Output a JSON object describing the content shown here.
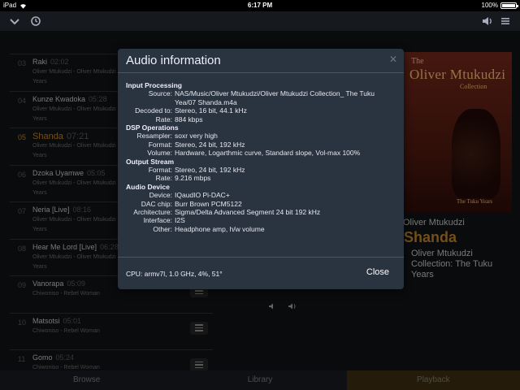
{
  "status_bar": {
    "device": "iPad",
    "time": "6:17 PM",
    "battery": "100%",
    "battery_level": 1.0
  },
  "queue": [
    {
      "num": "03",
      "title": "Raki",
      "duration": "02:02",
      "artist": "Oliver Mtukudzi - Oliver Mtukudzi Collection",
      "years": "Years",
      "current": false,
      "menu": false
    },
    {
      "num": "04",
      "title": "Kunze Kwadoka",
      "duration": "05:28",
      "artist": "Oliver Mtukudzi - Oliver Mtukudzi Collection",
      "years": "Years",
      "current": false,
      "menu": false
    },
    {
      "num": "05",
      "title": "Shanda",
      "duration": "07:21",
      "artist": "Oliver Mtukudzi - Oliver Mtukudzi Collection",
      "years": "Years",
      "current": true,
      "menu": false
    },
    {
      "num": "06",
      "title": "Dzoka Uyamwe",
      "duration": "05:05",
      "artist": "Oliver Mtukudzi - Oliver Mtukudzi Collection",
      "years": "Years",
      "current": false,
      "menu": false
    },
    {
      "num": "07",
      "title": "Neria [Live]",
      "duration": "08:16",
      "artist": "Oliver Mtukudzi - Oliver Mtukudzi Collection",
      "years": "Years",
      "current": false,
      "menu": false
    },
    {
      "num": "08",
      "title": "Hear Me Lord [Live]",
      "duration": "06:28",
      "artist": "Oliver Mtukudzi - Oliver Mtukudzi Collection",
      "years": "Years",
      "current": false,
      "menu": false
    },
    {
      "num": "09",
      "title": "Vanorapa",
      "duration": "05:09",
      "artist": "Chiwoniso - Rebel Woman",
      "years": "",
      "current": false,
      "menu": true
    },
    {
      "num": "10",
      "title": "Matsotsi",
      "duration": "05:01",
      "artist": "Chiwoniso - Rebel Woman",
      "years": "",
      "current": false,
      "menu": true
    },
    {
      "num": "11",
      "title": "Gomo",
      "duration": "05:24",
      "artist": "Chiwoniso - Rebel Woman",
      "years": "",
      "current": false,
      "menu": true
    }
  ],
  "album_art": {
    "line1": "The",
    "line2": "Oliver Mtukudzi",
    "line3": "Collection",
    "line4": "The Tuku Years"
  },
  "now_playing": {
    "artist": "Oliver Mtukudzi",
    "title": "Shanda",
    "album": "Oliver Mtukudzi Collection: The Tuku Years"
  },
  "tabs": [
    {
      "label": "Browse",
      "active": false
    },
    {
      "label": "Library",
      "active": false
    },
    {
      "label": "Playback",
      "active": true
    }
  ],
  "modal": {
    "title": "Audio information",
    "input_processing": {
      "heading": "Input Processing",
      "source_label": "Source:",
      "source_value": "NAS/Music/Oliver Mtukudzi/Oliver Mtukudzi Collection_ The Tuku Yea/07 Shanda.m4a",
      "decoded_label": "Decoded to:",
      "decoded_value": "Stereo, 16 bit, 44.1 kHz",
      "rate_label": "Rate:",
      "rate_value": "884 kbps"
    },
    "dsp": {
      "heading": "DSP Operations",
      "resampler_label": "Resampler:",
      "resampler_value": "soxr very high",
      "format_label": "Format:",
      "format_value": "Stereo, 24 bit, 192 kHz",
      "volume_label": "Volume:",
      "volume_value": "Hardware, Logarthmic curve, Standard slope, Vol-max 100%"
    },
    "output": {
      "heading": "Output Stream",
      "format_label": "Format:",
      "format_value": "Stereo, 24 bit, 192 kHz",
      "rate_label": "Rate:",
      "rate_value": "9.216 mbps"
    },
    "device": {
      "heading": "Audio Device",
      "device_label": "Device:",
      "device_value": "IQaudIO Pi-DAC+",
      "dac_label": "DAC chip:",
      "dac_value": "Burr Brown PCM5122",
      "arch_label": "Architecture:",
      "arch_value": "Sigma/Delta Advanced Segment 24 bit 192 kHz",
      "interface_label": "Interface:",
      "interface_value": "I2S",
      "other_label": "Other:",
      "other_value": "Headphone amp, h/w volume"
    },
    "cpu": "CPU: armv7l, 1.0 GHz, 4%, 51°",
    "close_label": "Close"
  }
}
